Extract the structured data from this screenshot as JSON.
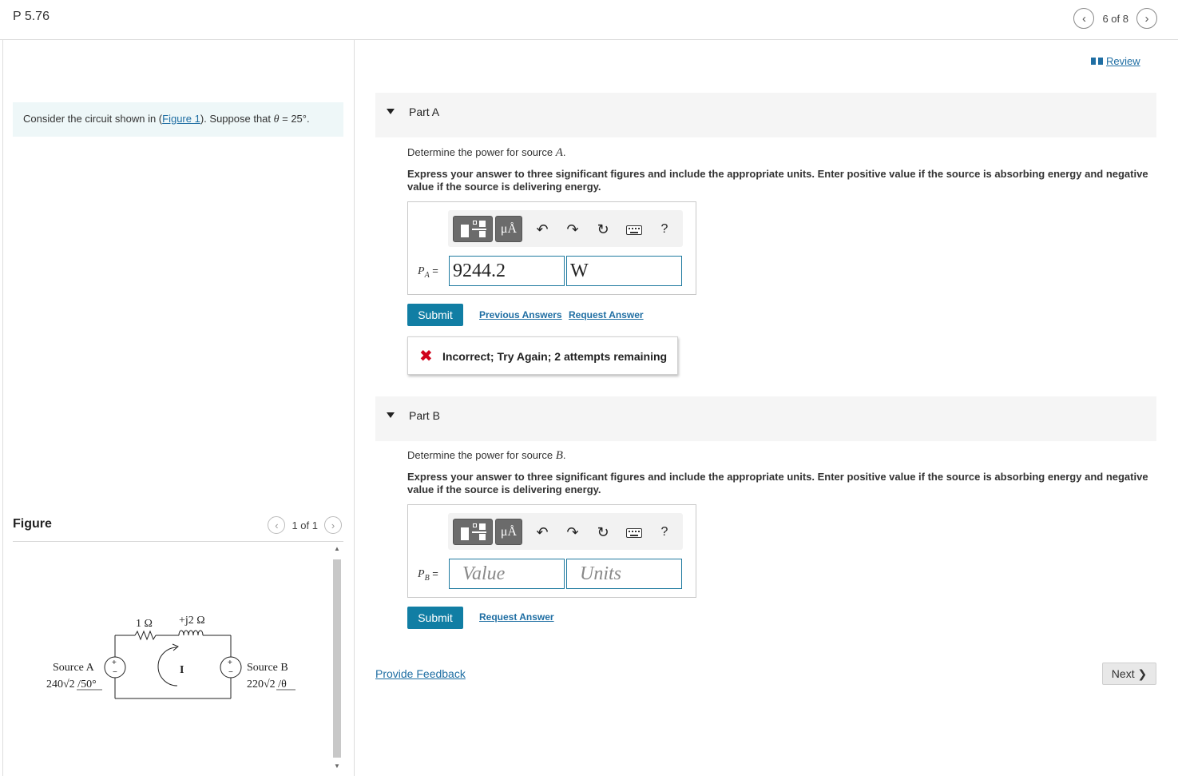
{
  "header": {
    "title": "P 5.76",
    "pager_text": "6 of 8"
  },
  "intro": {
    "text_before": "Consider the circuit shown in (",
    "figure_link": "Figure 1",
    "text_after": "). Suppose that ",
    "theta": "θ",
    "value": " = 25°."
  },
  "figure": {
    "title": "Figure",
    "pager_text": "1 of 1",
    "circuit": {
      "r_label": "1 Ω",
      "l_label": "+j2 Ω",
      "current_label": "I",
      "source_a_name": "Source A",
      "source_a_value": "240√2 /50°",
      "source_b_name": "Source B",
      "source_b_value": "220√2 /θ",
      "plus": "+",
      "minus": "−"
    }
  },
  "review": {
    "label": "Review"
  },
  "part_a": {
    "title": "Part A",
    "question": "Determine the power for source ",
    "source": "A",
    "period": ".",
    "instructions": "Express your answer to three significant figures and include the appropriate units. Enter positive value if the source is absorbing energy and negative value if the source is delivering energy.",
    "var_label": "P",
    "var_sub": "A",
    "equals": " =",
    "value": "9244.2",
    "units": "W",
    "submit": "Submit",
    "previous_answers": "Previous Answers",
    "request_answer": "Request Answer",
    "feedback": "Incorrect; Try Again; 2 attempts remaining"
  },
  "part_b": {
    "title": "Part B",
    "question": "Determine the power for source ",
    "source": "B",
    "period": ".",
    "instructions": "Express your answer to three significant figures and include the appropriate units. Enter positive value if the source is absorbing energy and negative value if the source is delivering energy.",
    "var_label": "P",
    "var_sub": "B",
    "equals": " =",
    "value_placeholder": "Value",
    "units_placeholder": "Units",
    "submit": "Submit",
    "request_answer": "Request Answer"
  },
  "toolbar": {
    "units_label": "μÅ",
    "help_label": "?",
    "undo_glyph": "↶",
    "redo_glyph": "↷",
    "reset_glyph": "↻"
  },
  "footer": {
    "provide_feedback": "Provide Feedback",
    "next": "Next ❯"
  },
  "nav": {
    "prev_glyph": "‹",
    "next_glyph": "›"
  },
  "colors": {
    "accent": "#117ea4",
    "link": "#1f6ea3",
    "error": "#d0021b",
    "intro_bg": "#eef7f8"
  }
}
